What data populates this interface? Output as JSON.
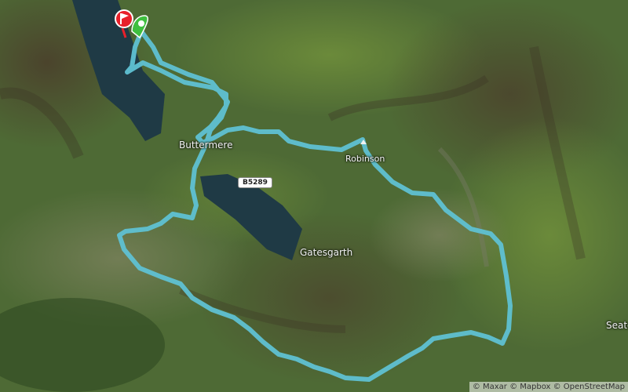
{
  "labels": {
    "buttermere": "Buttermere",
    "robinson": "Robinson",
    "gatesgarth": "Gatesgarth",
    "seatoller": "Seato"
  },
  "road": {
    "b5289": "B5289"
  },
  "attribution": "© Maxar © Mapbox © OpenStreetMap",
  "route": {
    "color": "#5fc1d3"
  },
  "markers": {
    "start_color": "#3fbf3f",
    "finish_color": "#e8202a"
  }
}
